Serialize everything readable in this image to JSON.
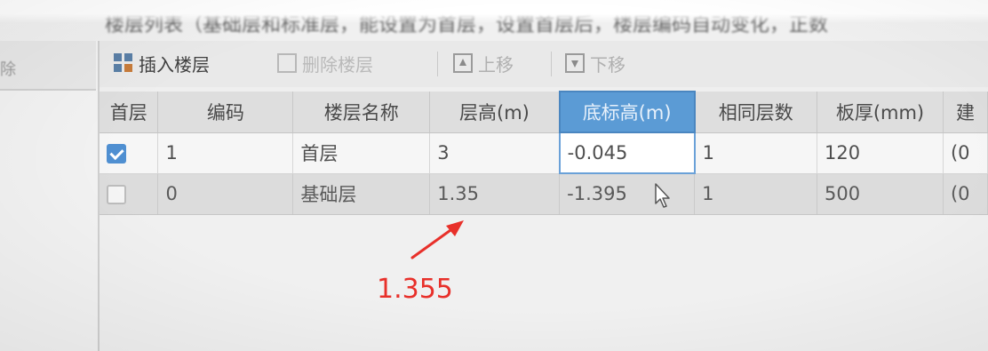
{
  "header": {
    "title": "楼层列表（基础层和标准层，能设置为首层，设置首层后，楼层编码自动变化，正数"
  },
  "left_panel": {
    "tab_label": "除"
  },
  "toolbar": {
    "insert_label": "插入楼层",
    "delete_label": "删除楼层",
    "up_label": "上移",
    "down_label": "下移",
    "insert_icon": "insert-floor-icon",
    "delete_icon": "delete-floor-icon",
    "up_icon": "move-up-icon",
    "down_icon": "move-down-icon"
  },
  "table": {
    "columns": [
      "首层",
      "编码",
      "楼层名称",
      "层高(m)",
      "底标高(m)",
      "相同层数",
      "板厚(mm)",
      "建"
    ],
    "rows": [
      {
        "is_first": true,
        "code": "1",
        "name": "首层",
        "height": "3",
        "bottom_elev": "-0.045",
        "same_count": "1",
        "slab": "120",
        "extra": "(0"
      },
      {
        "is_first": false,
        "code": "0",
        "name": "基础层",
        "height": "1.35",
        "bottom_elev": "-1.395",
        "same_count": "1",
        "slab": "500",
        "extra": "(0"
      }
    ]
  },
  "annotation": {
    "text": "1.355",
    "color": "#e8302a"
  },
  "colors": {
    "accent": "#5b9bd5",
    "checkbox": "#4f8fd1"
  }
}
